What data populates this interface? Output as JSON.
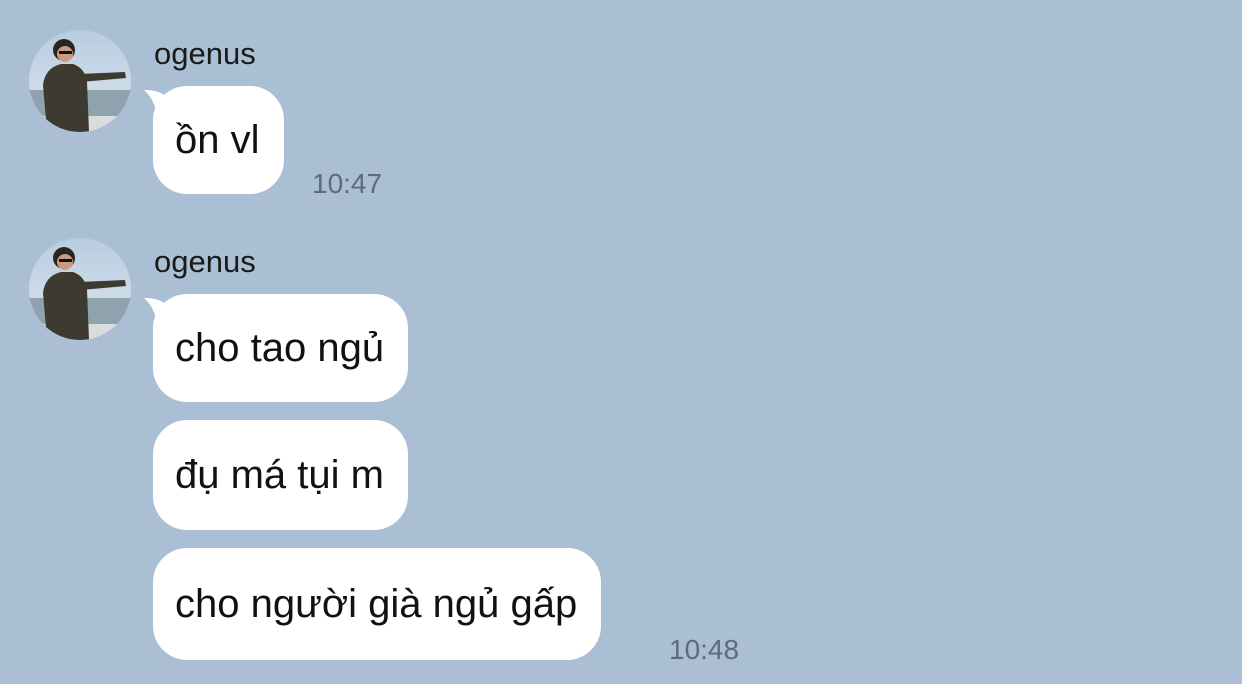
{
  "messages": [
    {
      "sender": "ogenus",
      "avatar": "user-avatar-photo",
      "bubbles": [
        "ồn vl"
      ],
      "time": "10:47"
    },
    {
      "sender": "ogenus",
      "avatar": "user-avatar-photo",
      "bubbles": [
        "cho tao ngủ",
        "đụ má tụi m",
        "cho người già ngủ gấp"
      ],
      "time": "10:48"
    }
  ],
  "colors": {
    "background": "#aabfd3",
    "bubble": "#ffffff",
    "timestamp": "#5f6b78"
  }
}
